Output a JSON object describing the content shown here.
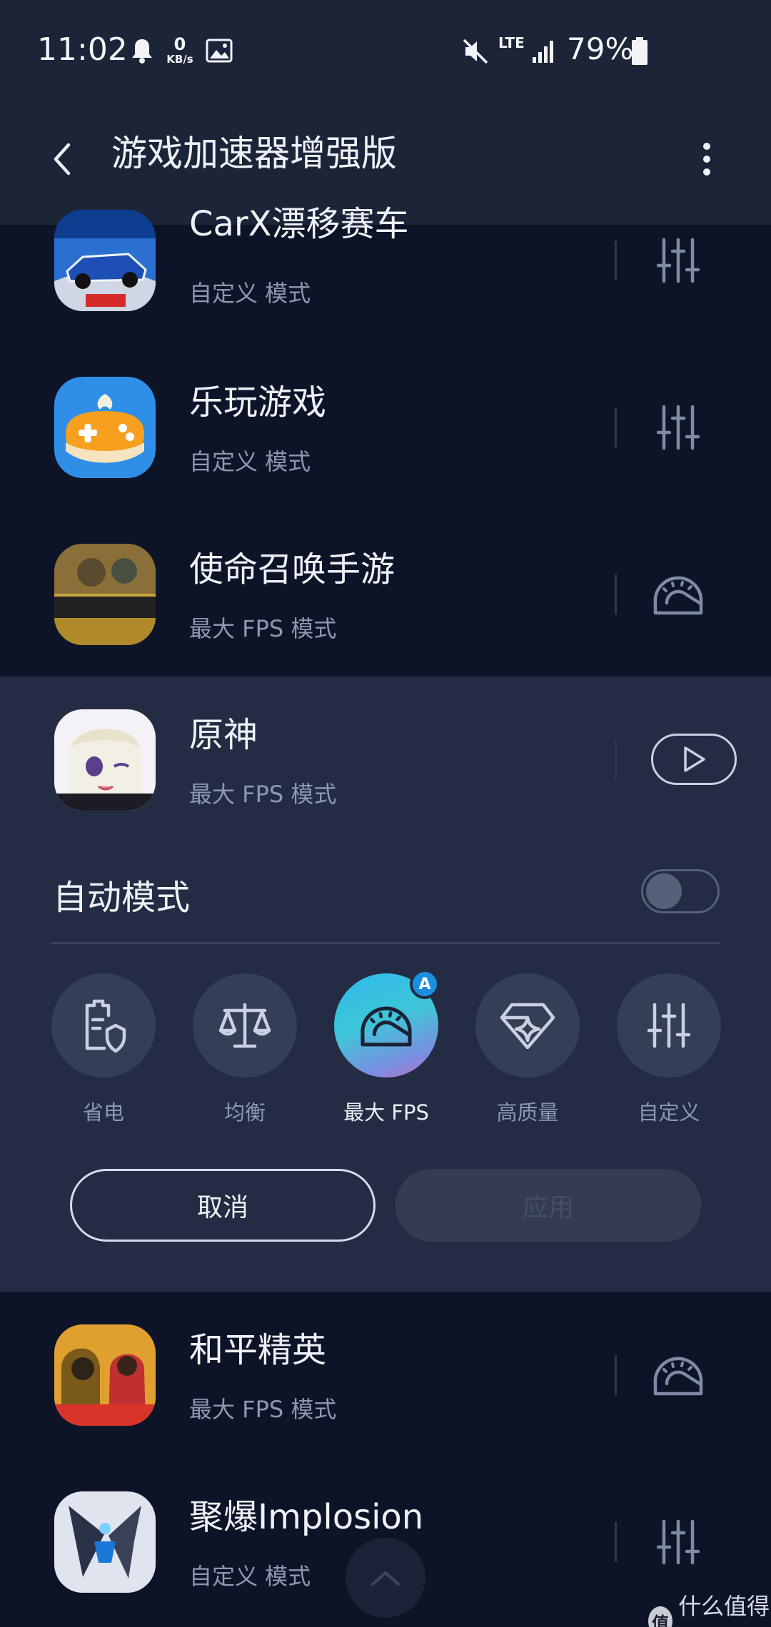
{
  "status_bar": {
    "time": "11:02",
    "net_speed_value": "0",
    "net_speed_unit": "KB/s",
    "network_type": "LTE",
    "battery_percent": "79%"
  },
  "app_bar": {
    "title": "游戏加速器增强版"
  },
  "games": [
    {
      "name": "CarX漂移赛车",
      "mode": "自定义 模式",
      "icon": "carx-racing-app-icon",
      "action_icon": "sliders-icon"
    },
    {
      "name": "乐玩游戏",
      "mode": "自定义 模式",
      "icon": "lewan-gamepad-app-icon",
      "action_icon": "sliders-icon"
    },
    {
      "name": "使命召唤手游",
      "mode": "最大 FPS 模式",
      "icon": "call-of-duty-app-icon",
      "action_icon": "speedometer-icon"
    },
    {
      "name": "原神",
      "mode": "最大 FPS 模式",
      "icon": "genshin-app-icon",
      "action_icon": "play-icon"
    },
    {
      "name": "和平精英",
      "mode": "最大 FPS 模式",
      "icon": "peace-elite-app-icon",
      "action_icon": "speedometer-icon"
    },
    {
      "name": "聚爆Implosion",
      "mode": "自定义 模式",
      "icon": "implosion-app-icon",
      "action_icon": "sliders-icon"
    }
  ],
  "panel": {
    "auto_mode_label": "自动模式",
    "auto_mode_on": false,
    "auto_badge": "A",
    "modes": [
      {
        "label": "省电",
        "icon": "battery-shield-icon",
        "selected": false
      },
      {
        "label": "均衡",
        "icon": "balance-scale-icon",
        "selected": false
      },
      {
        "label": "最大 FPS",
        "icon": "speedometer-icon",
        "selected": true
      },
      {
        "label": "高质量",
        "icon": "diamond-sparkle-icon",
        "selected": false
      },
      {
        "label": "自定义",
        "icon": "sliders-icon",
        "selected": false
      }
    ],
    "cancel_label": "取消",
    "apply_label": "应用"
  },
  "watermark": {
    "logo_text": "值",
    "text": "什么值得买"
  },
  "colors": {
    "background": "#0e1428",
    "header": "#1c2438",
    "panel": "#232c42",
    "mode_circle": "#343e56",
    "muted_text": "#8d97b0",
    "accent_badge": "#1a8fe0"
  }
}
